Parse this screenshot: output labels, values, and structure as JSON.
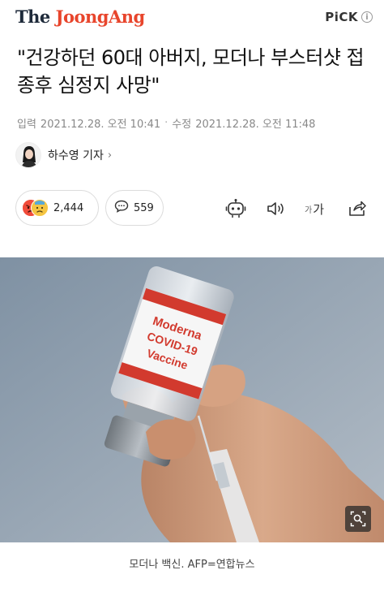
{
  "header": {
    "logo_the": "The",
    "logo_brand": "JoongAng",
    "pick_label": "PiCK",
    "pick_info": "i"
  },
  "article": {
    "headline": "\"건강하던 60대 아버지, 모더나 부스터샷 접종후 심정지 사망\"",
    "published_label": "입력",
    "published": "2021.12.28. 오전 10:41",
    "modified_label": "수정",
    "modified": "2021.12.28. 오전 11:48",
    "reporter": "하수영 기자",
    "reporter_chevron": "›"
  },
  "actions": {
    "reaction_count": "2,444",
    "comment_count": "559",
    "font_size_small": "가",
    "font_size_large": "가"
  },
  "photo": {
    "vial_label_line1": "Moderna",
    "vial_label_line2": "COVID-19",
    "vial_label_line3": "Vaccine",
    "caption": "모더나 백신. AFP=연합뉴스"
  },
  "colors": {
    "brand_red": "#e8452c",
    "logo_dark": "#1e2a3a",
    "muted_text": "#888888"
  }
}
